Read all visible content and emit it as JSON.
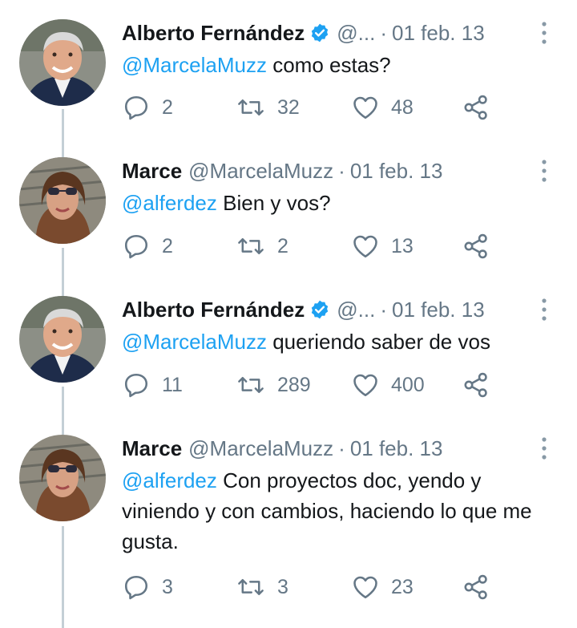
{
  "tweets": [
    {
      "author": "Alberto Fernández",
      "verified": true,
      "handle": "@...",
      "date": "01 feb. 13",
      "mention": "@MarcelaMuzz",
      "text": " como estas?",
      "replies": "2",
      "retweets": "32",
      "likes": "48",
      "avatar": "avatar-alberto"
    },
    {
      "author": "Marce",
      "verified": false,
      "handle": "@MarcelaMuzz",
      "date": "01 feb. 13",
      "mention": "@alferdez",
      "text": " Bien y vos?",
      "replies": "2",
      "retweets": "2",
      "likes": "13",
      "avatar": "avatar-marce"
    },
    {
      "author": "Alberto Fernández",
      "verified": true,
      "handle": "@...",
      "date": "01 feb. 13",
      "mention": "@MarcelaMuzz",
      "text": " queriendo saber de vos",
      "replies": "11",
      "retweets": "289",
      "likes": "400",
      "avatar": "avatar-alberto"
    },
    {
      "author": "Marce",
      "verified": false,
      "handle": "@MarcelaMuzz",
      "date": "01 feb. 13",
      "mention": "@alferdez",
      "text": " Con proyectos doc, yendo y viniendo y con cambios, haciendo lo que me gusta.",
      "replies": "3",
      "retweets": "3",
      "likes": "23",
      "avatar": "avatar-marce"
    }
  ],
  "separator": "·",
  "colors": {
    "link": "#1da1f2",
    "secondary_text": "#657786",
    "thread_line": "#c4cfd6",
    "primary_text": "#14171a"
  },
  "icons": {
    "reply": "reply-icon",
    "retweet": "retweet-icon",
    "like": "heart-icon",
    "share": "share-icon",
    "more": "more-vertical-icon",
    "verified": "verified-badge-icon"
  }
}
